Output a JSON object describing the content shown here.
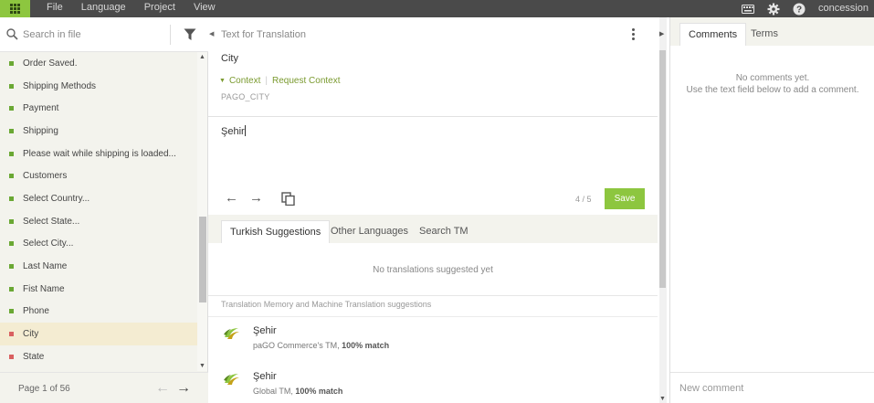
{
  "menu": [
    "File",
    "Language",
    "Project",
    "View"
  ],
  "user": "concession",
  "search": {
    "placeholder": "Search in file"
  },
  "strings": [
    {
      "label": "Order Saved.",
      "status": "ok"
    },
    {
      "label": "Shipping Methods",
      "status": "ok"
    },
    {
      "label": "Payment",
      "status": "ok"
    },
    {
      "label": "Shipping",
      "status": "ok"
    },
    {
      "label": "Please wait while shipping is loaded...",
      "status": "ok"
    },
    {
      "label": "Customers",
      "status": "ok"
    },
    {
      "label": "Select Country...",
      "status": "ok"
    },
    {
      "label": "Select State...",
      "status": "ok"
    },
    {
      "label": "Select City...",
      "status": "ok"
    },
    {
      "label": "Last Name",
      "status": "ok"
    },
    {
      "label": "Fist Name",
      "status": "ok"
    },
    {
      "label": "Phone",
      "status": "ok"
    },
    {
      "label": "City",
      "status": "bad",
      "active": true
    },
    {
      "label": "State",
      "status": "bad"
    }
  ],
  "pager": {
    "text": "Page 1 of 56"
  },
  "source": {
    "header": "Text for Translation",
    "text": "City",
    "context_label": "Context",
    "request_context": "Request Context",
    "key": "PAGO_CITY"
  },
  "translation": {
    "value": "Şehir",
    "progress": "4 / 5",
    "save_label": "Save"
  },
  "suggestion_tabs": [
    "Turkish Suggestions",
    "Other Languages",
    "Search TM"
  ],
  "no_suggestions": "No translations suggested yet",
  "tm_header": "Translation Memory and Machine Translation suggestions",
  "tm_suggestions": [
    {
      "text": "Şehir",
      "source": "paGO Commerce's TM,",
      "match": "100% match"
    },
    {
      "text": "Şehir",
      "source": "Global TM,",
      "match": "100% match"
    }
  ],
  "right_tabs": [
    "Comments",
    "Terms"
  ],
  "comments": {
    "empty_line1": "No comments yet.",
    "empty_line2": "Use the text field below to add a comment.",
    "placeholder": "New comment"
  },
  "colors": {
    "accent": "#8dc63f",
    "ok": "#6aa834",
    "bad": "#d96060",
    "topbar": "#4a4a4a"
  }
}
